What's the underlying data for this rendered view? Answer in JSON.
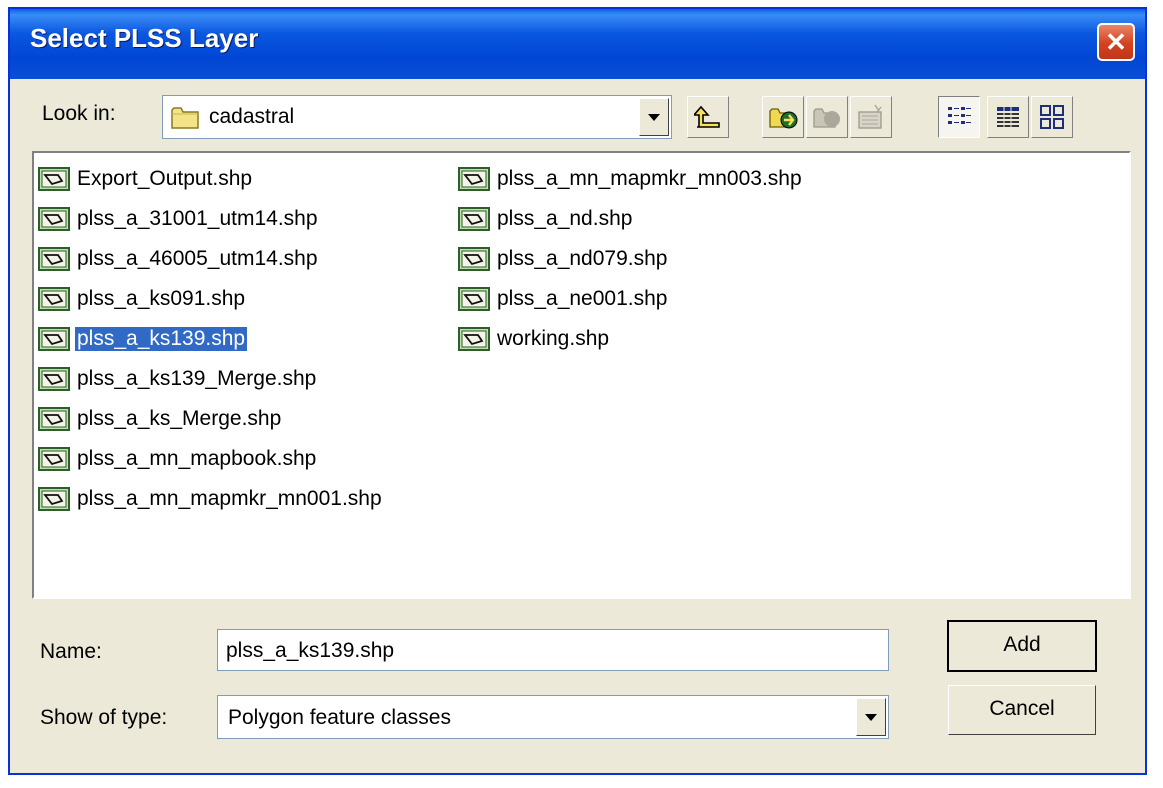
{
  "dialog": {
    "title": "Select PLSS Layer",
    "close_icon": "close-icon",
    "accent_color": "#0a57e0"
  },
  "look_in": {
    "label": "Look in:",
    "value": "cadastral",
    "icon": "folder-icon"
  },
  "toolbar": {
    "buttons": [
      {
        "icon": "up-one-level-icon"
      },
      {
        "icon": "connect-to-folder-icon"
      },
      {
        "icon": "disconnect-folder-icon"
      },
      {
        "icon": "view-properties-icon"
      },
      {
        "icon": "list-view-icon"
      },
      {
        "icon": "details-view-icon"
      },
      {
        "icon": "thumbnails-view-icon"
      }
    ]
  },
  "files": {
    "icon": "polygon-shapefile-icon",
    "selected": "plss_a_ks139.shp",
    "column1": [
      "Export_Output.shp",
      "plss_a_31001_utm14.shp",
      "plss_a_46005_utm14.shp",
      "plss_a_ks091.shp",
      "plss_a_ks139.shp",
      "plss_a_ks139_Merge.shp",
      "plss_a_ks_Merge.shp",
      "plss_a_mn_mapbook.shp",
      "plss_a_mn_mapmkr_mn001.shp"
    ],
    "column2": [
      "plss_a_mn_mapmkr_mn003.shp",
      "plss_a_nd.shp",
      "plss_a_nd079.shp",
      "plss_a_ne001.shp",
      "working.shp"
    ]
  },
  "name_field": {
    "label": "Name:",
    "value": "plss_a_ks139.shp"
  },
  "type_field": {
    "label": "Show of type:",
    "value": "Polygon feature classes"
  },
  "buttons": {
    "add": "Add",
    "cancel": "Cancel"
  }
}
